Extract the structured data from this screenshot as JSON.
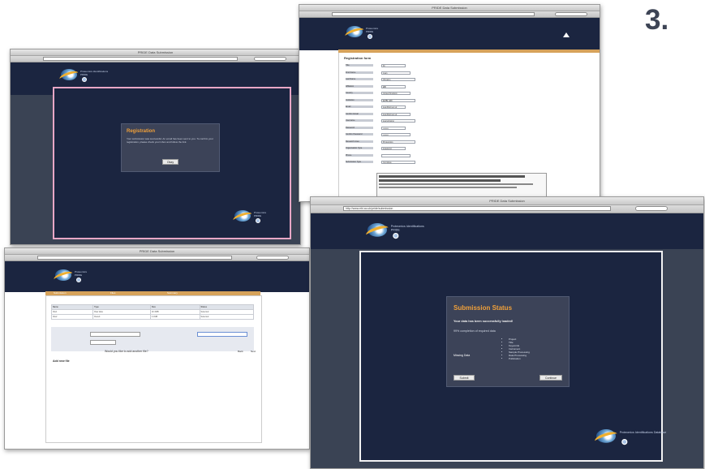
{
  "step_number": "3.",
  "window_registration": {
    "title": "PRIDE Data Submission",
    "modal": {
      "title": "Registration",
      "message": "Your submission was successful. An email has been sent to you. To confirm your registration, please check your inbox and follow the link.",
      "ok_label": "Okay"
    }
  },
  "window_form": {
    "title": "PRIDE Data Submission",
    "heading": "Registration form",
    "fields": [
      {
        "label": "Title",
        "value": "Dr."
      },
      {
        "label": "First Name",
        "value": "Juan"
      },
      {
        "label": "Last Name",
        "value": "Vizcaino"
      },
      {
        "label": "Affiliation",
        "value": "EBI"
      },
      {
        "label": "Country",
        "value": "United Kingdom"
      },
      {
        "label": "Institution",
        "value": "EMBL-EBI"
      },
      {
        "label": "Email",
        "value": "juan@ebi.ac.uk"
      },
      {
        "label": "Confirm Email",
        "value": "juan@ebi.ac.uk"
      },
      {
        "label": "Username",
        "value": "juanvizcaino"
      },
      {
        "label": "Password",
        "value": "••••••••"
      },
      {
        "label": "Confirm Password",
        "value": "••••••••"
      },
      {
        "label": "Research Area",
        "value": "Proteomics"
      },
      {
        "label": "Organisation Type",
        "value": "Academic"
      },
      {
        "label": "Phone",
        "value": ""
      },
      {
        "label": "Submission Type",
        "value": "Complete"
      }
    ]
  },
  "window_table": {
    "title": "PRIDE Data Submission",
    "tabs": [
      "Submission",
      "Files",
      "Summary"
    ],
    "headers": [
      "Name",
      "Type",
      "Size",
      "Status"
    ],
    "rows": [
      [
        "File1",
        "Raw data",
        "20.3MB",
        "Selected"
      ],
      [
        "File2",
        "Result",
        "4.1MB",
        "Selected"
      ]
    ],
    "question": "Would you like to add another file?",
    "back_label": "Back",
    "next_label": "Next",
    "add_label": "Add new file"
  },
  "window_status": {
    "title": "PRIDE Data Submission",
    "address": "http://www.ebi.ac.uk/pride/submission",
    "modal": {
      "title": "Submission Status",
      "line1": "Your data has been successfully loaded!",
      "line2": "99% completion of required data",
      "details_label": "Missing Data",
      "items": [
        "Project",
        "Title",
        "Keywords",
        "Instrument",
        "Sample Processing",
        "Data Processing",
        "Publication"
      ],
      "left_button": "Submit",
      "right_button": "Continue"
    },
    "logo_text": "Proteomics Identifications Database"
  }
}
